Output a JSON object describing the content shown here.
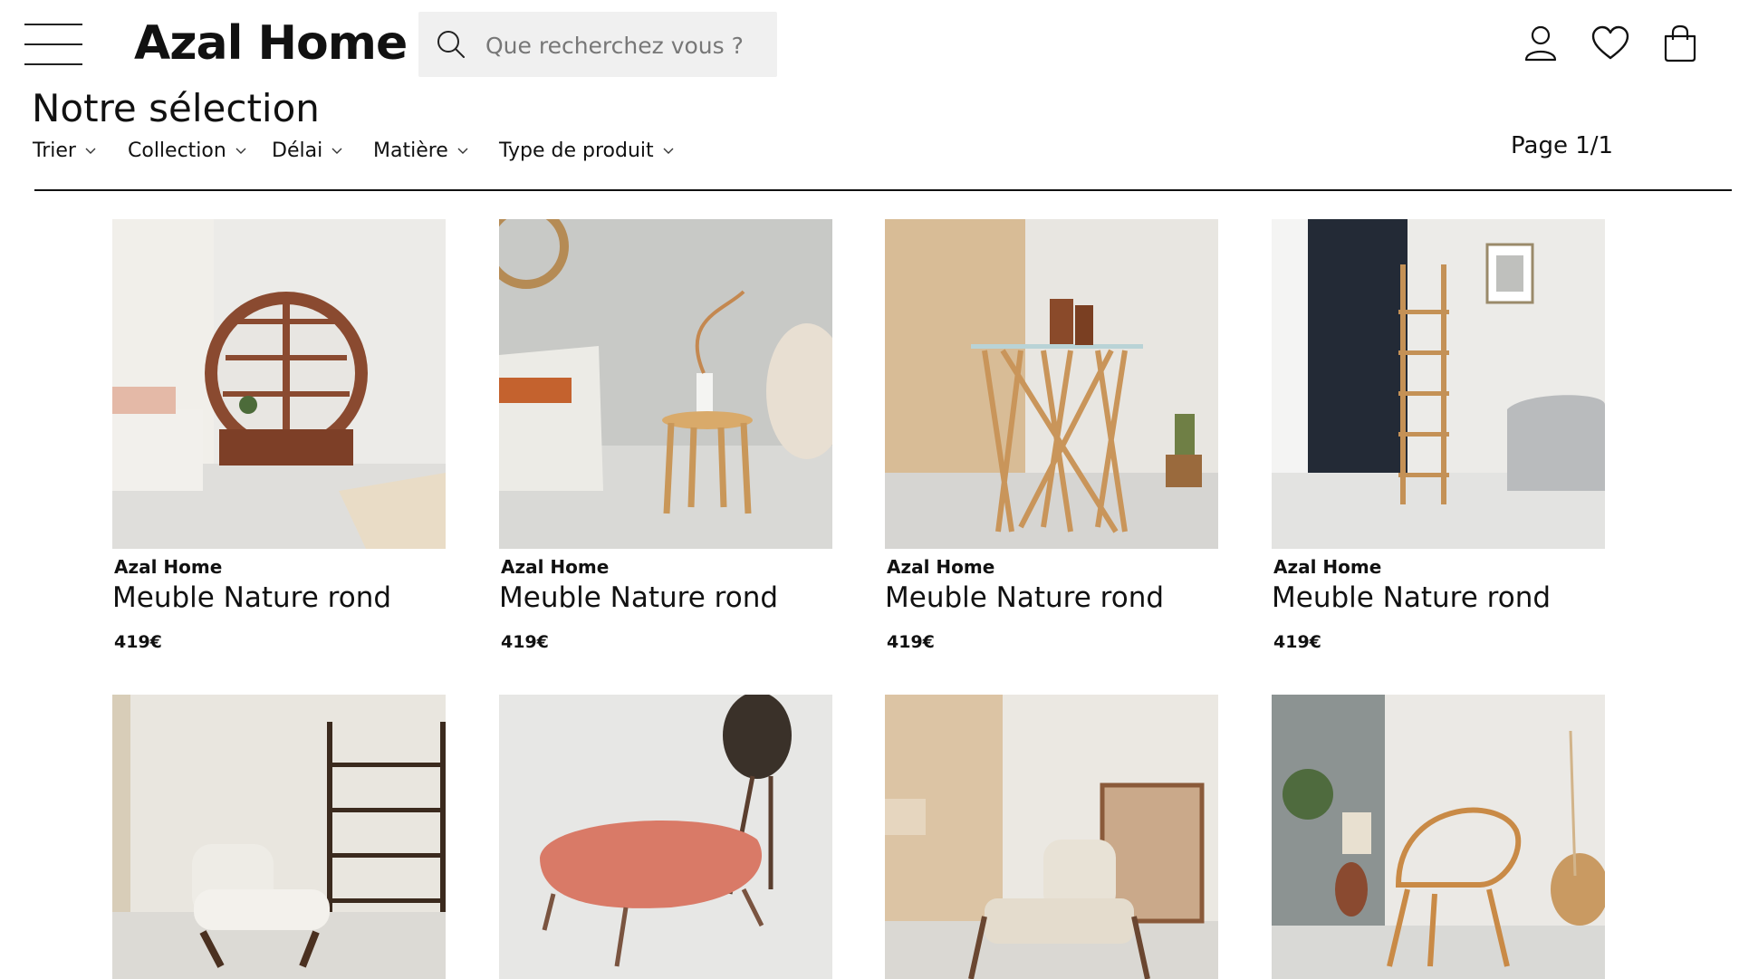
{
  "brand": {
    "name": "Azal Home"
  },
  "search": {
    "placeholder": "Que recherchez vous ?"
  },
  "header_icons": [
    "menu-icon",
    "search-icon",
    "user-icon",
    "heart-icon",
    "bag-icon"
  ],
  "page": {
    "title": "Notre sélection",
    "indicator": "Page 1/1"
  },
  "filters": [
    {
      "label": "Trier"
    },
    {
      "label": "Collection"
    },
    {
      "label": "Délai"
    },
    {
      "label": "Matière"
    },
    {
      "label": "Type de produit"
    }
  ],
  "products": [
    {
      "brand": "Azal Home",
      "name": "Meuble Nature rond",
      "price": "419€"
    },
    {
      "brand": "Azal Home",
      "name": "Meuble Nature rond",
      "price": "419€"
    },
    {
      "brand": "Azal Home",
      "name": "Meuble Nature rond",
      "price": "419€"
    },
    {
      "brand": "Azal Home",
      "name": "Meuble Nature rond",
      "price": "419€"
    },
    {},
    {},
    {},
    {}
  ],
  "colors": {
    "text": "#111111",
    "search_bg": "#f0f0f0",
    "divider": "#111111"
  }
}
